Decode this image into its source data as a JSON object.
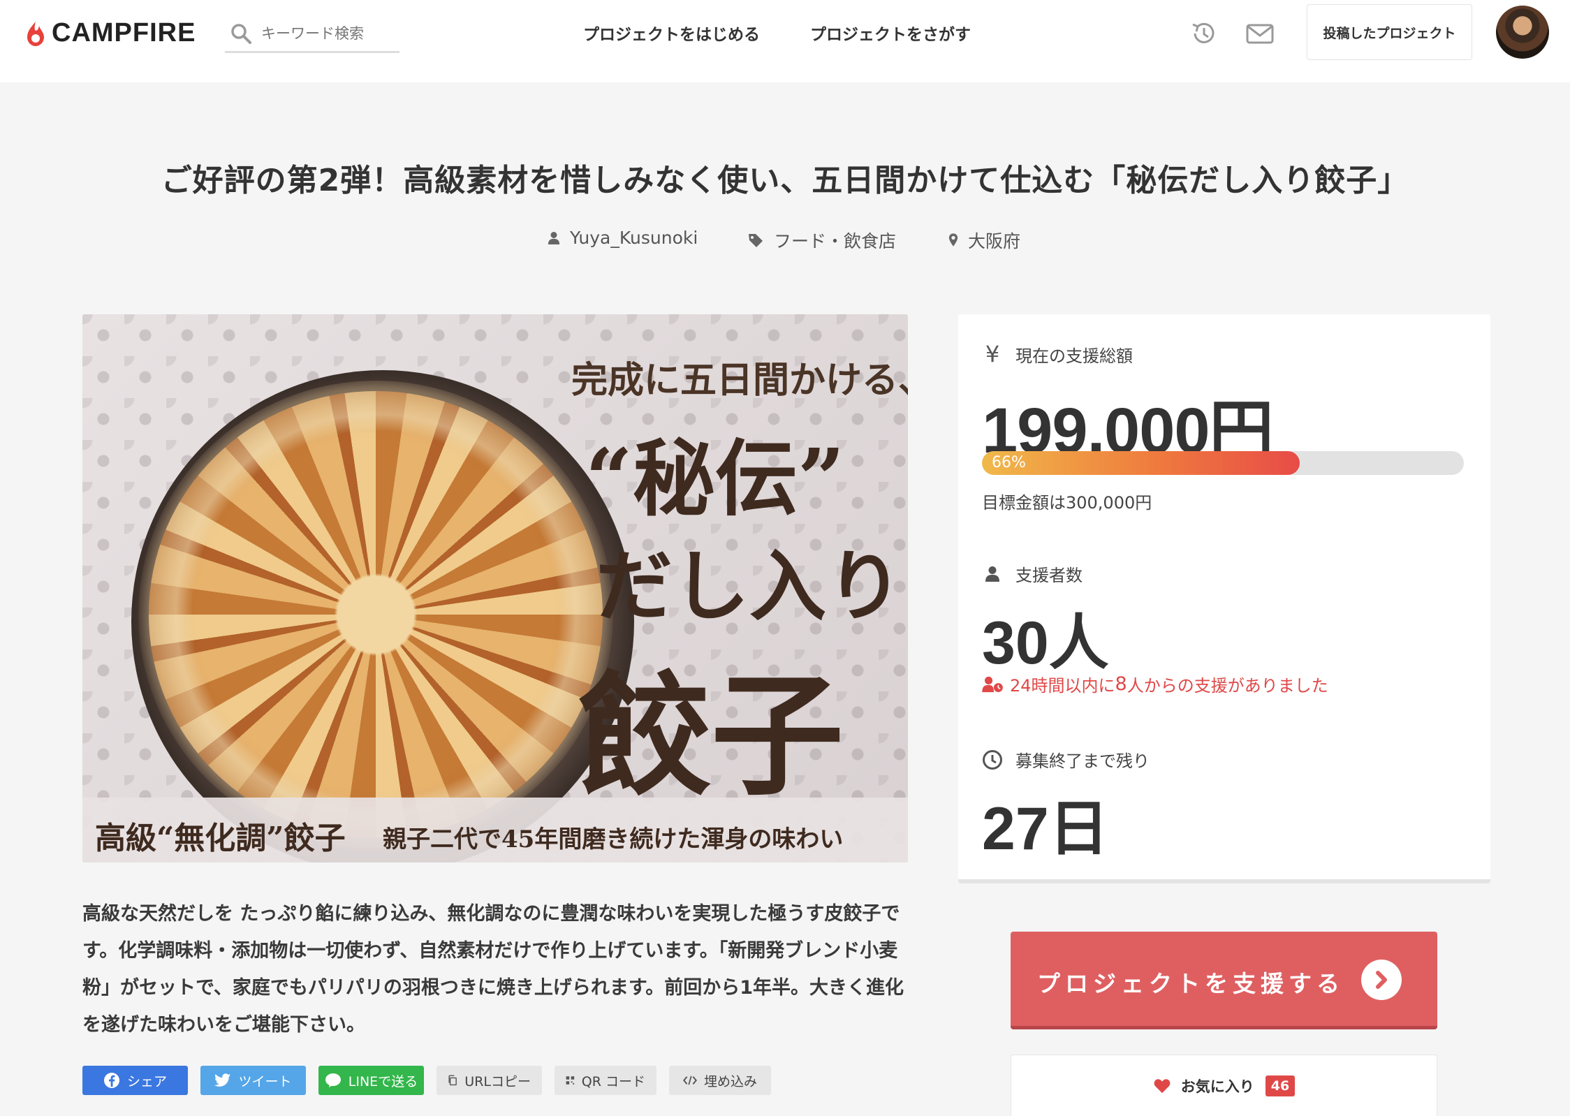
{
  "header": {
    "logo_text": "CAMPFIRE",
    "search_placeholder": "キーワード検索",
    "nav": [
      "プロジェクトをはじめる",
      "プロジェクトをさがす"
    ],
    "my_projects_label": "投稿したプロジェクト",
    "icons": [
      "history-icon",
      "mail-icon"
    ]
  },
  "project": {
    "title": "ご好評の第2弾！高級素材を惜しみなく使い、五日間かけて仕込む「秘伝だし入り餃子」",
    "author": "Yuya_Kusunoki",
    "category": "フード・飲食店",
    "location": "大阪府"
  },
  "hero": {
    "line1": "完成に五日間かける、",
    "line2": "“秘伝”",
    "line3": "だし入り",
    "line4": "餃子",
    "band_main": "高級“無化調”餃子",
    "band_sub": "親子二代で45年間磨き続けた渾身の味わい"
  },
  "description": "高級な天然だしを たっぷり餡に練り込み、無化調なのに豊潤な味わいを実現した極うす皮餃子です。化学調味料・添加物は一切使わず、自然素材だけで作り上げています。「新開発ブレンド小麦粉」がセットで、家庭でもパリパリの羽根つきに焼き上げられます。前回から1年半。大きく進化を遂げた味わいをご堪能下さい。",
  "share": {
    "facebook": "シェア",
    "twitter": "ツイート",
    "line": "LINEで送る",
    "url_copy": "URLコピー",
    "qr": "QR コード",
    "embed": "埋め込み"
  },
  "stats": {
    "amount_label": "現在の支援総額",
    "amount": "199,000円",
    "progress_percent": 66,
    "progress_label": "66%",
    "goal": "目標金額は300,000円",
    "backers_label": "支援者数",
    "backers": "30人",
    "recent_prefix": "24時間以内に",
    "recent_count": "8",
    "recent_suffix": "人からの支援がありました",
    "remaining_label": "募集終了まで残り",
    "remaining": "27日"
  },
  "cta": {
    "support_label": "プロジェクトを支援する",
    "favorite_label": "お気に入り",
    "favorite_count": "46"
  },
  "colors": {
    "accent": "#df5f61",
    "progress_start": "#f0b94a",
    "progress_end": "#e74c47",
    "facebook": "#3b77e0",
    "twitter": "#55a6e8",
    "line": "#33b64b"
  }
}
